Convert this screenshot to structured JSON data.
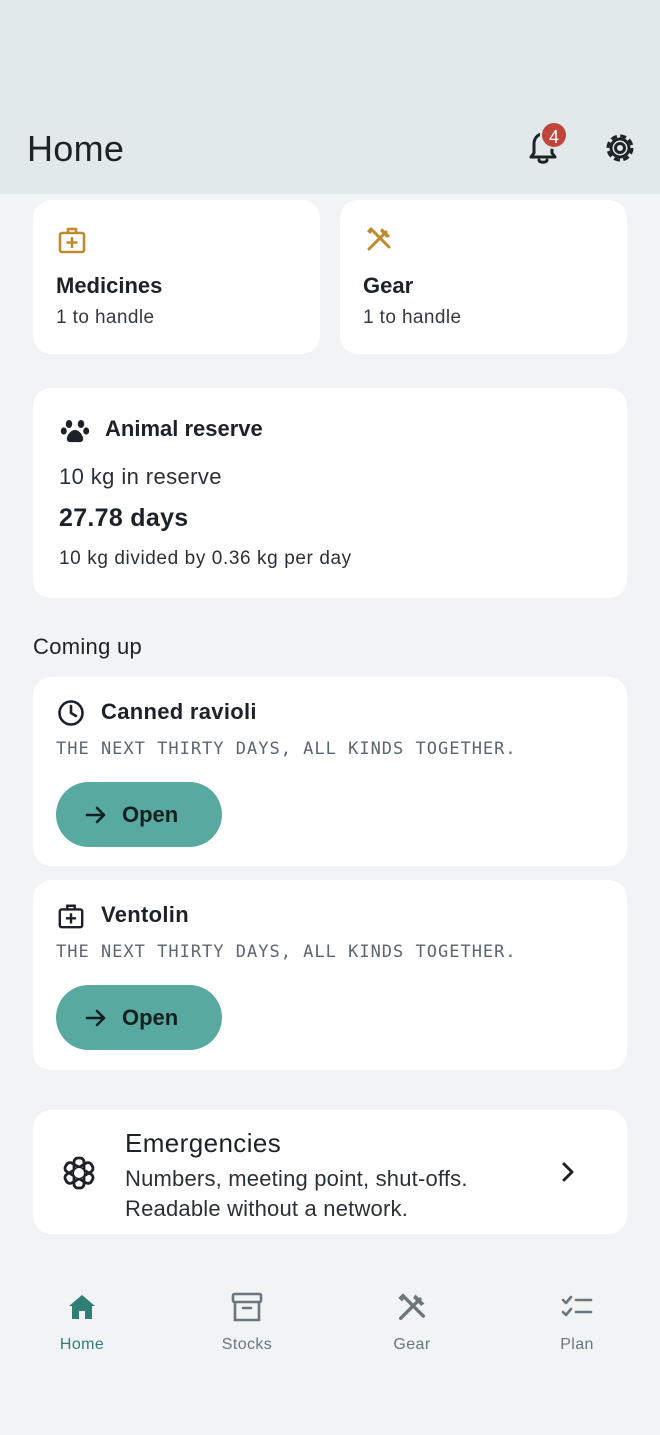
{
  "header": {
    "title": "Home",
    "notification_count": "4"
  },
  "stats": [
    {
      "title": "Medicines",
      "sub": "1 to handle",
      "icon": "medkit-icon"
    },
    {
      "title": "Gear",
      "sub": "1 to handle",
      "icon": "tools-icon"
    }
  ],
  "reserve": {
    "title": "Animal reserve",
    "amount": "10 kg in reserve",
    "days": "27.78 days",
    "calc": "10 kg divided by 0.36 kg per day"
  },
  "coming_up": {
    "label": "Coming up",
    "items": [
      {
        "title": "Canned ravioli",
        "sub": "THE NEXT THIRTY DAYS, ALL KINDS TOGETHER.",
        "button": "Open",
        "icon": "clock-icon"
      },
      {
        "title": "Ventolin",
        "sub": "THE NEXT THIRTY DAYS, ALL KINDS TOGETHER.",
        "button": "Open",
        "icon": "medkit-icon"
      }
    ]
  },
  "emergencies": {
    "title": "Emergencies",
    "sub1": "Numbers, meeting point, shut-offs.",
    "sub2": "Readable without a network."
  },
  "nav": [
    {
      "label": "Home",
      "active": true
    },
    {
      "label": "Stocks",
      "active": false
    },
    {
      "label": "Gear",
      "active": false
    },
    {
      "label": "Plan",
      "active": false
    }
  ],
  "colors": {
    "accent": "#58a9a0",
    "active_nav": "#2f7f74",
    "icon_gold": "#c08a2e",
    "badge": "#c0453a",
    "header_bg": "#e2e9eb"
  }
}
